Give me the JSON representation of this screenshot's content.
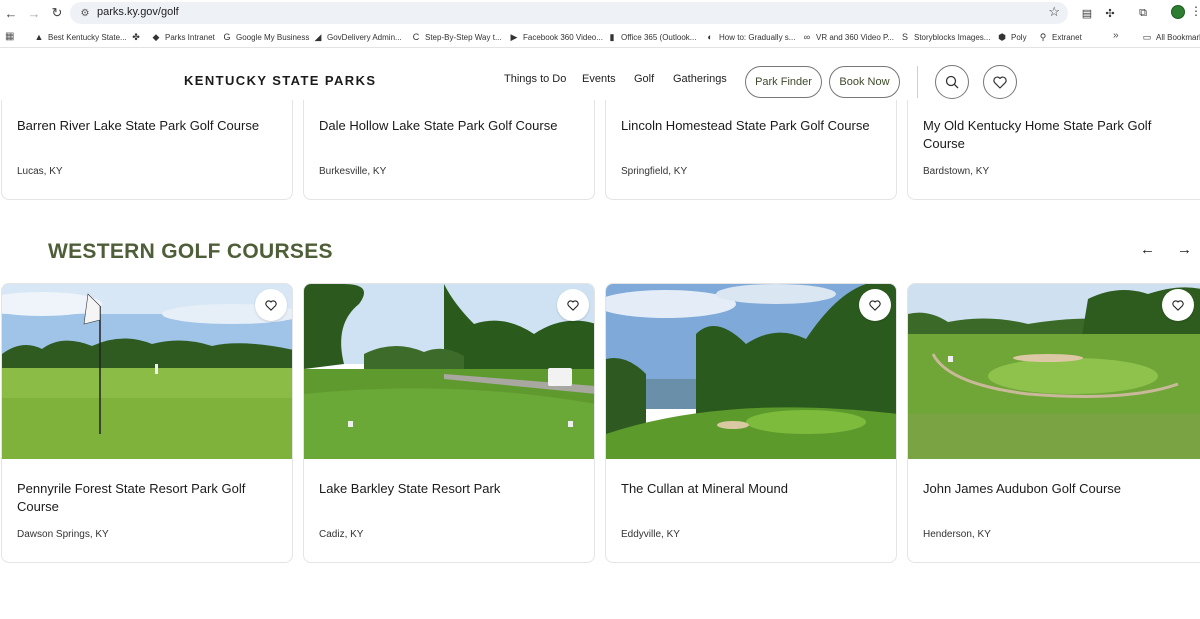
{
  "browser": {
    "url": "parks.ky.gov/golf",
    "bookmarks": [
      {
        "label": "Best Kentucky State...",
        "icon": "bookmark-arrow-icon"
      },
      {
        "label": "",
        "icon": "pinwheel-icon"
      },
      {
        "label": "Parks Intranet",
        "icon": "intranet-icon"
      },
      {
        "label": "Google My Business",
        "icon": "google-icon"
      },
      {
        "label": "GovDelivery Admin...",
        "icon": "govdelivery-icon"
      },
      {
        "label": "Step-By-Step Way t...",
        "icon": "step-icon"
      },
      {
        "label": "Facebook 360 Video...",
        "icon": "facebook-video-icon"
      },
      {
        "label": "Office 365 (Outlook...",
        "icon": "office-icon"
      },
      {
        "label": "How to: Gradually s...",
        "icon": "howto-icon"
      },
      {
        "label": "VR and 360 Video P...",
        "icon": "vr-icon"
      },
      {
        "label": "Storyblocks Images...",
        "icon": "storyblocks-icon"
      },
      {
        "label": "Poly",
        "icon": "poly-icon"
      },
      {
        "label": "Extranet",
        "icon": "pin-icon"
      }
    ],
    "more_label": "»",
    "all_bookmarks": "All Bookmarks"
  },
  "header": {
    "logo": "KENTUCKY STATE PARKS",
    "nav": [
      "Things to Do",
      "Events",
      "Golf",
      "Gatherings"
    ],
    "park_finder": "Park Finder",
    "book_now": "Book Now"
  },
  "top_courses": [
    {
      "title": "Barren River Lake State Park Golf Course",
      "location": "Lucas, KY"
    },
    {
      "title": "Dale Hollow Lake State Park Golf Course",
      "location": "Burkesville, KY"
    },
    {
      "title": "Lincoln Homestead State Park Golf Course",
      "location": "Springfield, KY"
    },
    {
      "title": "My Old Kentucky Home State Park Golf Course",
      "location": "Bardstown, KY"
    }
  ],
  "western": {
    "heading": "WESTERN GOLF COURSES",
    "courses": [
      {
        "title": "Pennyrile Forest State Resort Park Golf Course",
        "location": "Dawson Springs, KY"
      },
      {
        "title": "Lake Barkley State Resort Park",
        "location": "Cadiz, KY"
      },
      {
        "title": "The Cullan at Mineral Mound",
        "location": "Eddyville, KY"
      },
      {
        "title": "John James Audubon Golf Course",
        "location": "Henderson, KY"
      }
    ]
  },
  "colors": {
    "accent_green": "#4e5e38",
    "pill_text": "#3d4a2b"
  }
}
